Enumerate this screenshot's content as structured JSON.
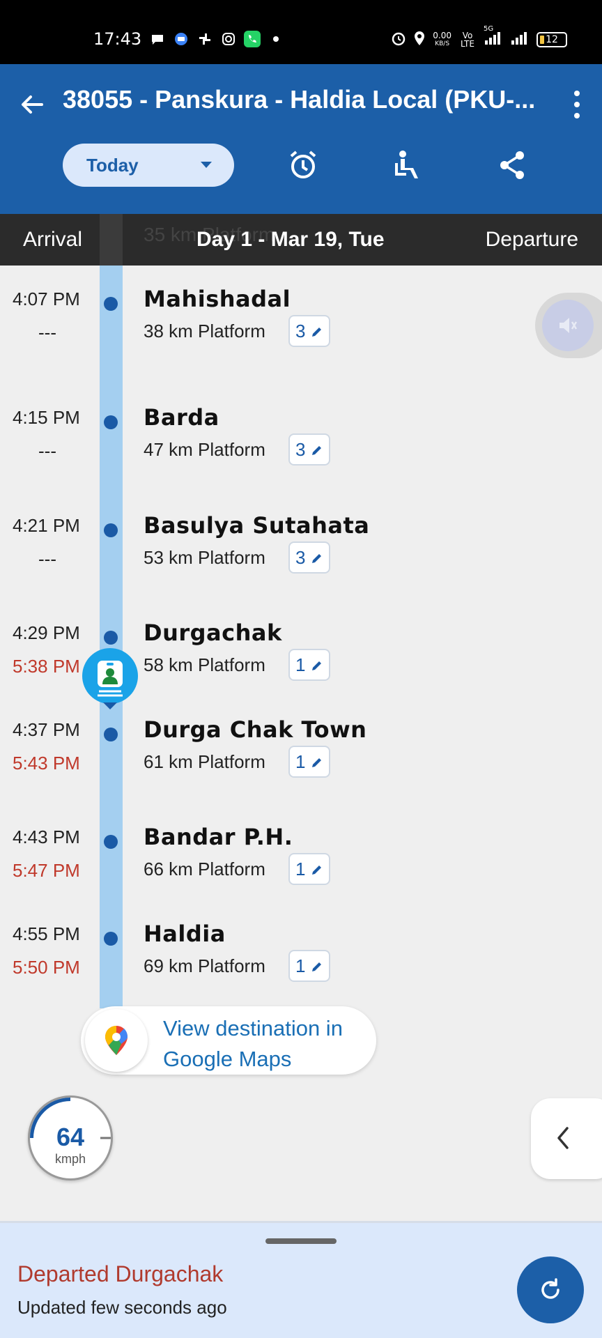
{
  "status_bar": {
    "time": "17:43",
    "net_speed_value": "0.00",
    "net_speed_unit": "KB/S",
    "volte_label": "Vo LTE",
    "network_label": "5G",
    "battery": "12",
    "icons_left": [
      "chat-icon",
      "message-icon",
      "pinwheel-icon",
      "instagram-icon",
      "phone-call-icon",
      "dot-icon"
    ],
    "icons_right": [
      "alarm-icon",
      "location-icon",
      "signal-icon",
      "signal-icon",
      "battery-icon"
    ]
  },
  "header": {
    "title": "38055 - Panskura - Haldia Local (PKU-...",
    "day_selector": "Today",
    "actions": [
      "alarm-icon",
      "seat-icon",
      "share-icon"
    ]
  },
  "column_header": {
    "arrival": "Arrival",
    "day": "Day 1 - Mar 19, Tue",
    "departure": "Departure",
    "scrolled_hint": "35 km Platform"
  },
  "stops": [
    {
      "name": "Mahishadal",
      "distance": "38 km",
      "platform_label": "Platform",
      "platform": "3",
      "arrival": "4:07 PM",
      "departure": "---",
      "late": false
    },
    {
      "name": "Barda",
      "distance": "47 km",
      "platform_label": "Platform",
      "platform": "3",
      "arrival": "4:15 PM",
      "departure": "---",
      "late": false
    },
    {
      "name": "Basulya Sutahata",
      "distance": "53 km",
      "platform_label": "Platform",
      "platform": "3",
      "arrival": "4:21 PM",
      "departure": "---",
      "late": false
    },
    {
      "name": "Durgachak",
      "distance": "58 km",
      "platform_label": "Platform",
      "platform": "1",
      "arrival": "4:29 PM",
      "departure": "5:38 PM",
      "late": true
    },
    {
      "name": "Durga Chak Town",
      "distance": "61 km",
      "platform_label": "Platform",
      "platform": "1",
      "arrival": "4:37 PM",
      "departure": "5:43 PM",
      "late": true
    },
    {
      "name": "Bandar P.H.",
      "distance": "66 km",
      "platform_label": "Platform",
      "platform": "1",
      "arrival": "4:43 PM",
      "departure": "5:47 PM",
      "late": true
    },
    {
      "name": "Haldia",
      "distance": "69 km",
      "platform_label": "Platform",
      "platform": "1",
      "arrival": "4:55 PM",
      "departure": "5:50 PM",
      "late": true
    }
  ],
  "maps_button": {
    "label": "View destination in Google Maps"
  },
  "speed": {
    "value": "64",
    "unit": "kmph"
  },
  "bottom_sheet": {
    "status": "Departed Durgachak",
    "updated": "Updated few seconds ago"
  },
  "colors": {
    "primary": "#1c5fa8",
    "track": "#a4cff0",
    "late": "#c0392b",
    "sheet": "#dbe8fb"
  }
}
